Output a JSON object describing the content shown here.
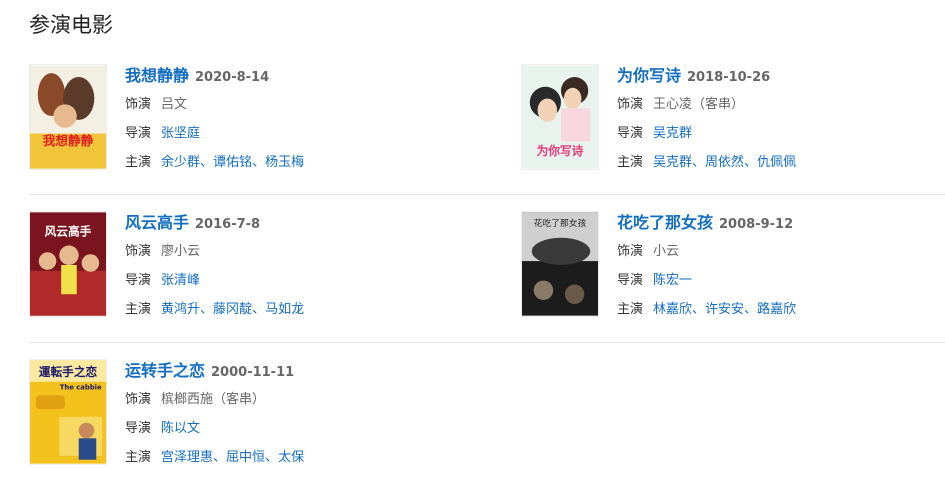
{
  "section": {
    "title": "参演电影"
  },
  "labels": {
    "role": "饰演",
    "director": "导演",
    "cast": "主演"
  },
  "movies": [
    {
      "title": "我想静静",
      "date": "2020-8-14",
      "role": "吕文",
      "director": "张坚庭",
      "cast": [
        "余少群",
        "谭佑铭",
        "杨玉梅"
      ]
    },
    {
      "title": "为你写诗",
      "date": "2018-10-26",
      "role": "王心凌（客串）",
      "director": "吴克群",
      "cast": [
        "吴克群",
        "周依然",
        "仇佩佩"
      ]
    },
    {
      "title": "风云高手",
      "date": "2016-7-8",
      "role": "廖小云",
      "director": "张清峰",
      "cast": [
        "黄鸿升",
        "藤冈靛",
        "马如龙"
      ]
    },
    {
      "title": "花吃了那女孩",
      "date": "2008-9-12",
      "role": "小云",
      "director": "陈宏一",
      "cast": [
        "林嘉欣",
        "许安安",
        "路嘉欣"
      ]
    },
    {
      "title": "运转手之恋",
      "date": "2000-11-11",
      "role": "槟榔西施（客串）",
      "director": "陈以文",
      "cast": [
        "宫泽理惠",
        "屈中恒",
        "太保"
      ]
    }
  ],
  "cast_separator": "、",
  "posters": {
    "p0": {
      "text": "我想静静"
    },
    "p1": {
      "text": "为你写诗"
    },
    "p2": {
      "text": "风云高手"
    },
    "p3": {
      "text": "花吃了那女孩"
    },
    "p4": {
      "text": "運転手之恋",
      "sub": "The cabbie"
    }
  }
}
